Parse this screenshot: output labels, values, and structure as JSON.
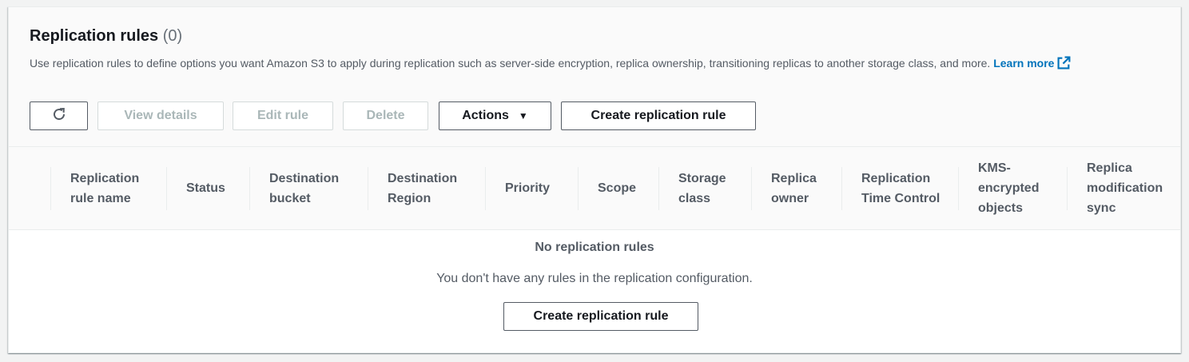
{
  "header": {
    "title": "Replication rules",
    "count": "(0)",
    "description": "Use replication rules to define options you want Amazon S3 to apply during replication such as server-side encryption, replica ownership, transitioning replicas to another storage class, and more.",
    "learn_more_label": "Learn more"
  },
  "toolbar": {
    "refresh_icon": "refresh-icon",
    "view_details_label": "View details",
    "edit_rule_label": "Edit rule",
    "delete_label": "Delete",
    "actions_label": "Actions",
    "actions_caret": "▼",
    "create_label": "Create replication rule"
  },
  "table": {
    "columns": [
      "Replication rule name",
      "Status",
      "Destination bucket",
      "Destination Region",
      "Priority",
      "Scope",
      "Storage class",
      "Replica owner",
      "Replication Time Control",
      "KMS-encrypted objects",
      "Replica modification sync"
    ]
  },
  "empty_state": {
    "title": "No replication rules",
    "description": "You don't have any rules in the replication configuration.",
    "create_label": "Create replication rule"
  },
  "colors": {
    "link": "#0073bb",
    "text": "#16191f",
    "muted": "#545b64",
    "disabled": "#aab7b8"
  }
}
